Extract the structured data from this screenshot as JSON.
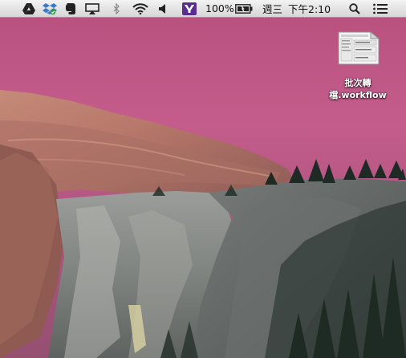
{
  "menubar": {
    "extras": [
      "google-drive-icon",
      "dropbox-icon",
      "evernote-icon",
      "airplay-icon",
      "bluetooth-icon",
      "wifi-icon",
      "volume-icon",
      "yahoo-icon"
    ],
    "battery_percent": "100%",
    "day": "週三",
    "time": "下午2:10",
    "right_icons": [
      "spotlight-search-icon",
      "notification-center-icon"
    ]
  },
  "desktop": {
    "file": {
      "name_line1": "批次轉",
      "name_line2": "檔.workflow"
    }
  },
  "colors": {
    "sky_top": "#b24a79",
    "sky_mid": "#c85f8f",
    "menubar": "#e6e6e6"
  }
}
